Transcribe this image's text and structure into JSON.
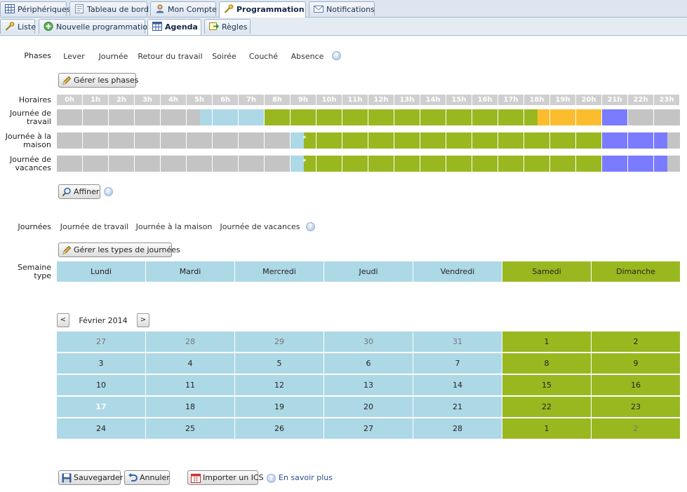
{
  "tabs": [
    {
      "label": "Périphériques",
      "icon": "grid-icon"
    },
    {
      "label": "Tableau de bord",
      "icon": "dashboard-icon"
    },
    {
      "label": "Mon Compte",
      "icon": "user-icon"
    },
    {
      "label": "Programmation",
      "icon": "key-icon",
      "active": true
    },
    {
      "label": "Notifications",
      "icon": "mail-icon"
    }
  ],
  "subtabs": [
    {
      "label": "Liste",
      "icon": "key-icon"
    },
    {
      "label": "Nouvelle programmation",
      "icon": "add-icon"
    },
    {
      "label": "Agenda",
      "icon": "calendar-icon",
      "active": true
    },
    {
      "label": "Règles",
      "icon": "rules-icon"
    }
  ],
  "phases": {
    "label": "Phases",
    "items": [
      {
        "label": "Lever",
        "color": "#add8e6"
      },
      {
        "label": "Journée",
        "color": "#99b820"
      },
      {
        "label": "Retour du travail",
        "color": "#fbbd2e"
      },
      {
        "label": "Soirée",
        "color": "#7b7bff"
      },
      {
        "label": "Couché",
        "color": "#c4c4c4"
      },
      {
        "label": "Absence",
        "color": "#3cc8c8"
      }
    ],
    "manage_label": "Gérer les phases"
  },
  "schedule": {
    "hours_label": "Horaires",
    "hours": [
      "0h",
      "1h",
      "2h",
      "3h",
      "4h",
      "5h",
      "6h",
      "7h",
      "8h",
      "9h",
      "10h",
      "11h",
      "12h",
      "13h",
      "14h",
      "15h",
      "16h",
      "17h",
      "18h",
      "19h",
      "20h",
      "21h",
      "22h",
      "23h"
    ],
    "rows": [
      {
        "label": "Journée de travail",
        "segments": [
          {
            "phase": "Couché",
            "from": 0,
            "to": 5.5
          },
          {
            "phase": "Lever",
            "from": 5.5,
            "to": 8
          },
          {
            "phase": "Journée",
            "from": 8,
            "to": 18.5
          },
          {
            "phase": "Retour du travail",
            "from": 18.5,
            "to": 21
          },
          {
            "phase": "Soirée",
            "from": 21,
            "to": 22
          },
          {
            "phase": "Couché",
            "from": 22,
            "to": 24
          }
        ],
        "marker": null
      },
      {
        "label": "Journée à la maison",
        "segments": [
          {
            "phase": "Couché",
            "from": 0,
            "to": 9
          },
          {
            "phase": "Lever",
            "from": 9,
            "to": 9.5
          },
          {
            "phase": "Journée",
            "from": 9.5,
            "to": 21
          },
          {
            "phase": "Soirée",
            "from": 21,
            "to": 23.5
          },
          {
            "phase": "Couché",
            "from": 23.5,
            "to": 24
          }
        ],
        "marker": {
          "at": 9.5,
          "text": "*"
        }
      },
      {
        "label": "Journée de vacances",
        "segments": [
          {
            "phase": "Couché",
            "from": 0,
            "to": 9
          },
          {
            "phase": "Lever",
            "from": 9,
            "to": 9.5
          },
          {
            "phase": "Journée",
            "from": 9.5,
            "to": 21
          },
          {
            "phase": "Soirée",
            "from": 21,
            "to": 23.5
          },
          {
            "phase": "Couché",
            "from": 23.5,
            "to": 24
          }
        ],
        "marker": {
          "at": 9.5,
          "text": "*"
        }
      }
    ],
    "refine_label": "Affiner"
  },
  "day_types": {
    "label": "Journées",
    "items": [
      {
        "label": "Journée de travail",
        "color": "#add8e6"
      },
      {
        "label": "Journée à la maison",
        "color": "#99b820"
      },
      {
        "label": "Journée de vacances",
        "color": "#fbbd2e"
      }
    ],
    "manage_label": "Gérer les types de journées"
  },
  "week": {
    "label": "Semaine type",
    "days": [
      {
        "label": "Lundi",
        "type": "Journée de travail"
      },
      {
        "label": "Mardi",
        "type": "Journée de travail"
      },
      {
        "label": "Mercredi",
        "type": "Journée de travail"
      },
      {
        "label": "Jeudi",
        "type": "Journée de travail"
      },
      {
        "label": "Vendredi",
        "type": "Journée de travail"
      },
      {
        "label": "Samedi",
        "type": "Journée à la maison"
      },
      {
        "label": "Dimanche",
        "type": "Journée à la maison"
      }
    ]
  },
  "calendar": {
    "month_label": "Février 2014",
    "prev_label": "<",
    "next_label": ">",
    "weeks": [
      [
        {
          "d": "27",
          "muted": true
        },
        {
          "d": "28",
          "muted": true
        },
        {
          "d": "29",
          "muted": true
        },
        {
          "d": "30",
          "muted": true
        },
        {
          "d": "31",
          "muted": true
        },
        {
          "d": "1"
        },
        {
          "d": "2"
        }
      ],
      [
        {
          "d": "3"
        },
        {
          "d": "4"
        },
        {
          "d": "5"
        },
        {
          "d": "6"
        },
        {
          "d": "7"
        },
        {
          "d": "8"
        },
        {
          "d": "9"
        }
      ],
      [
        {
          "d": "10"
        },
        {
          "d": "11"
        },
        {
          "d": "12"
        },
        {
          "d": "13"
        },
        {
          "d": "14"
        },
        {
          "d": "15"
        },
        {
          "d": "16"
        }
      ],
      [
        {
          "d": "17",
          "today": true
        },
        {
          "d": "18"
        },
        {
          "d": "19"
        },
        {
          "d": "20"
        },
        {
          "d": "21"
        },
        {
          "d": "22"
        },
        {
          "d": "23"
        }
      ],
      [
        {
          "d": "24"
        },
        {
          "d": "25"
        },
        {
          "d": "26"
        },
        {
          "d": "27"
        },
        {
          "d": "28"
        },
        {
          "d": "1"
        },
        {
          "d": "2",
          "muted": true
        }
      ]
    ]
  },
  "footer": {
    "save_label": "Sauvegarder",
    "cancel_label": "Annuler",
    "import_label": "Importer un ICS",
    "learn_more_label": "En savoir plus"
  }
}
